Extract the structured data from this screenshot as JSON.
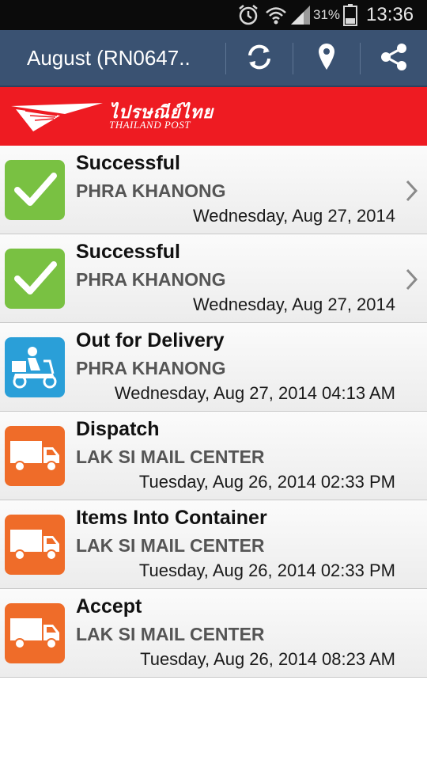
{
  "status_bar": {
    "battery_percent": "31%",
    "time": "13:36",
    "icons": [
      "alarm-icon",
      "wifi-icon",
      "signal-icon",
      "battery-icon"
    ]
  },
  "action_bar": {
    "title": "August (RN0647..",
    "actions": [
      "refresh-icon",
      "location-pin-icon",
      "share-icon"
    ]
  },
  "brand": {
    "name_thai": "ไปรษณีย์ไทย",
    "name_en": "THAILAND POST",
    "color": "#ee1b22"
  },
  "colors": {
    "success": "#79c142",
    "delivery": "#2a9fd8",
    "transit": "#ef6c29"
  },
  "tracking_events": [
    {
      "status": "Successful",
      "location": "PHRA KHANONG",
      "datetime": "Wednesday, Aug 27, 2014",
      "icon": "check-icon",
      "chevron": true
    },
    {
      "status": "Successful",
      "location": "PHRA KHANONG",
      "datetime": "Wednesday, Aug 27, 2014",
      "icon": "check-icon",
      "chevron": true
    },
    {
      "status": "Out for Delivery",
      "location": "PHRA KHANONG",
      "datetime": "Wednesday, Aug 27, 2014 04:13 AM",
      "icon": "scooter-icon",
      "chevron": false
    },
    {
      "status": "Dispatch",
      "location": "LAK SI MAIL CENTER",
      "datetime": "Tuesday, Aug 26, 2014 02:33 PM",
      "icon": "truck-icon",
      "chevron": false
    },
    {
      "status": "Items Into Container",
      "location": "LAK SI MAIL CENTER",
      "datetime": "Tuesday, Aug 26, 2014 02:33 PM",
      "icon": "truck-icon",
      "chevron": false
    },
    {
      "status": "Accept",
      "location": "LAK SI MAIL CENTER",
      "datetime": "Tuesday, Aug 26, 2014 08:23 AM",
      "icon": "truck-icon",
      "chevron": false
    }
  ]
}
